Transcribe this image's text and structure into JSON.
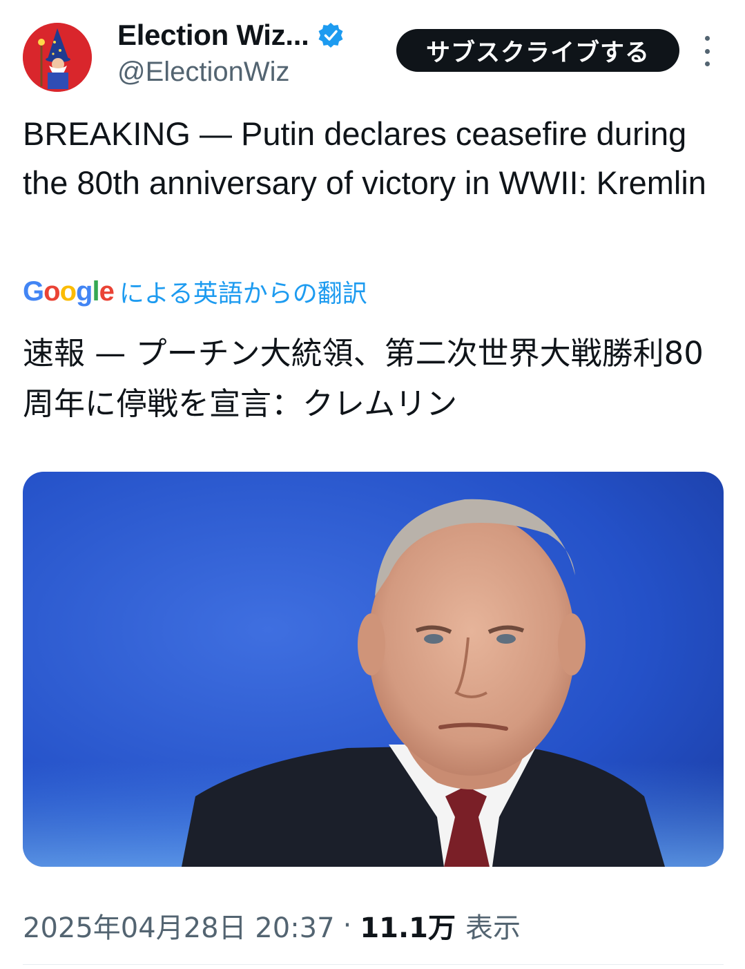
{
  "account": {
    "display_name": "Election Wiz...",
    "handle": "@ElectionWiz",
    "verified": true,
    "avatar_icon": "wizard-icon"
  },
  "actions": {
    "subscribe_label": "サブスクライブする",
    "more_icon": "more-vertical-icon"
  },
  "tweet": {
    "text": "BREAKING — Putin declares ceasefire during the 80th anniversary of victory in WWII: Kremlin"
  },
  "translation": {
    "provider_logo": "Google",
    "label": "による英語からの翻訳",
    "text": "速報 — プーチン大統領、第二次世界大戦勝利80周年に停戦を宣言：クレムリン"
  },
  "media": {
    "type": "photo"
  },
  "meta": {
    "timestamp": "2025年04月28日 20:37",
    "separator": "·",
    "views": "11.1万",
    "views_label": "表示"
  },
  "colors": {
    "text": "#0f1419",
    "secondary": "#536471",
    "link": "#1d9bf0",
    "verified": "#1d9bf0",
    "button_bg": "#0f1419"
  }
}
